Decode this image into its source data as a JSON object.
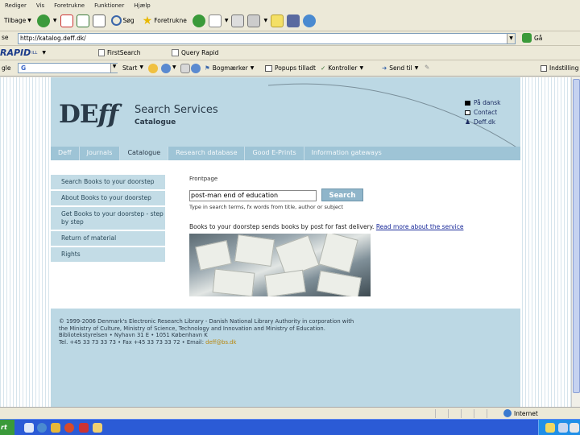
{
  "browser": {
    "menu": [
      "Rediger",
      "Vis",
      "Foretrukne",
      "Funktioner",
      "Hjælp"
    ],
    "back_label": "Tilbage",
    "search_label": "Søg",
    "favorites_label": "Foretrukne",
    "address_label": "se",
    "address_value": "http://katalog.deff.dk/",
    "go_label": "Gå",
    "links_rapid": "RAPID",
    "links_rapid_ill": "ILL",
    "links_firstsearch": "FirstSearch",
    "links_query_rapid": "Query Rapid",
    "google_label": "gle",
    "google_g": "G",
    "google_start": "Start",
    "google_pagerank": "Bogmærker",
    "google_popups": "Popups tilladt",
    "google_check": "Kontroller",
    "google_sendto": "Send til",
    "google_settings": "Indstilling",
    "status_zone": "Internet"
  },
  "site": {
    "logo_de": "DE",
    "logo_ff": "ff",
    "title": "Search Services",
    "subtitle": "Catalogue",
    "header_links": [
      "På dansk",
      "Contact",
      "Deff.dk"
    ],
    "nav": [
      "Deff",
      "Journals",
      "Catalogue",
      "Research database",
      "Good E-Prints",
      "Information gateways"
    ],
    "nav_active_index": 2,
    "left_menu": [
      "Search Books to your doorstep",
      "About Books to your doorstep",
      "Get Books to your doorstep - step by step",
      "Return of material",
      "Rights"
    ],
    "breadcrumb": "Frontpage",
    "search_value": "post-man end of education",
    "search_button": "Search",
    "search_hint": "Type in search terms, fx words from title, author or subject",
    "promo_text": "Books to your doorstep sends books by post for fast delivery.",
    "promo_link": "Read more about the service",
    "footer_lines": [
      "© 1999-2006 Denmark's Electronic Research Library - Danish National Library Authority in corporation with",
      "the Ministry of Culture, Ministry of Science, Technology and Innovation and Ministry of Education.",
      "Bibliotekstyrelsen • Nyhavn 31 E • 1051 København K",
      "Tel. +45 33 73 33 73 • Fax +45 33 73 33 72 • Email:"
    ],
    "footer_email": "deff@bs.dk"
  }
}
